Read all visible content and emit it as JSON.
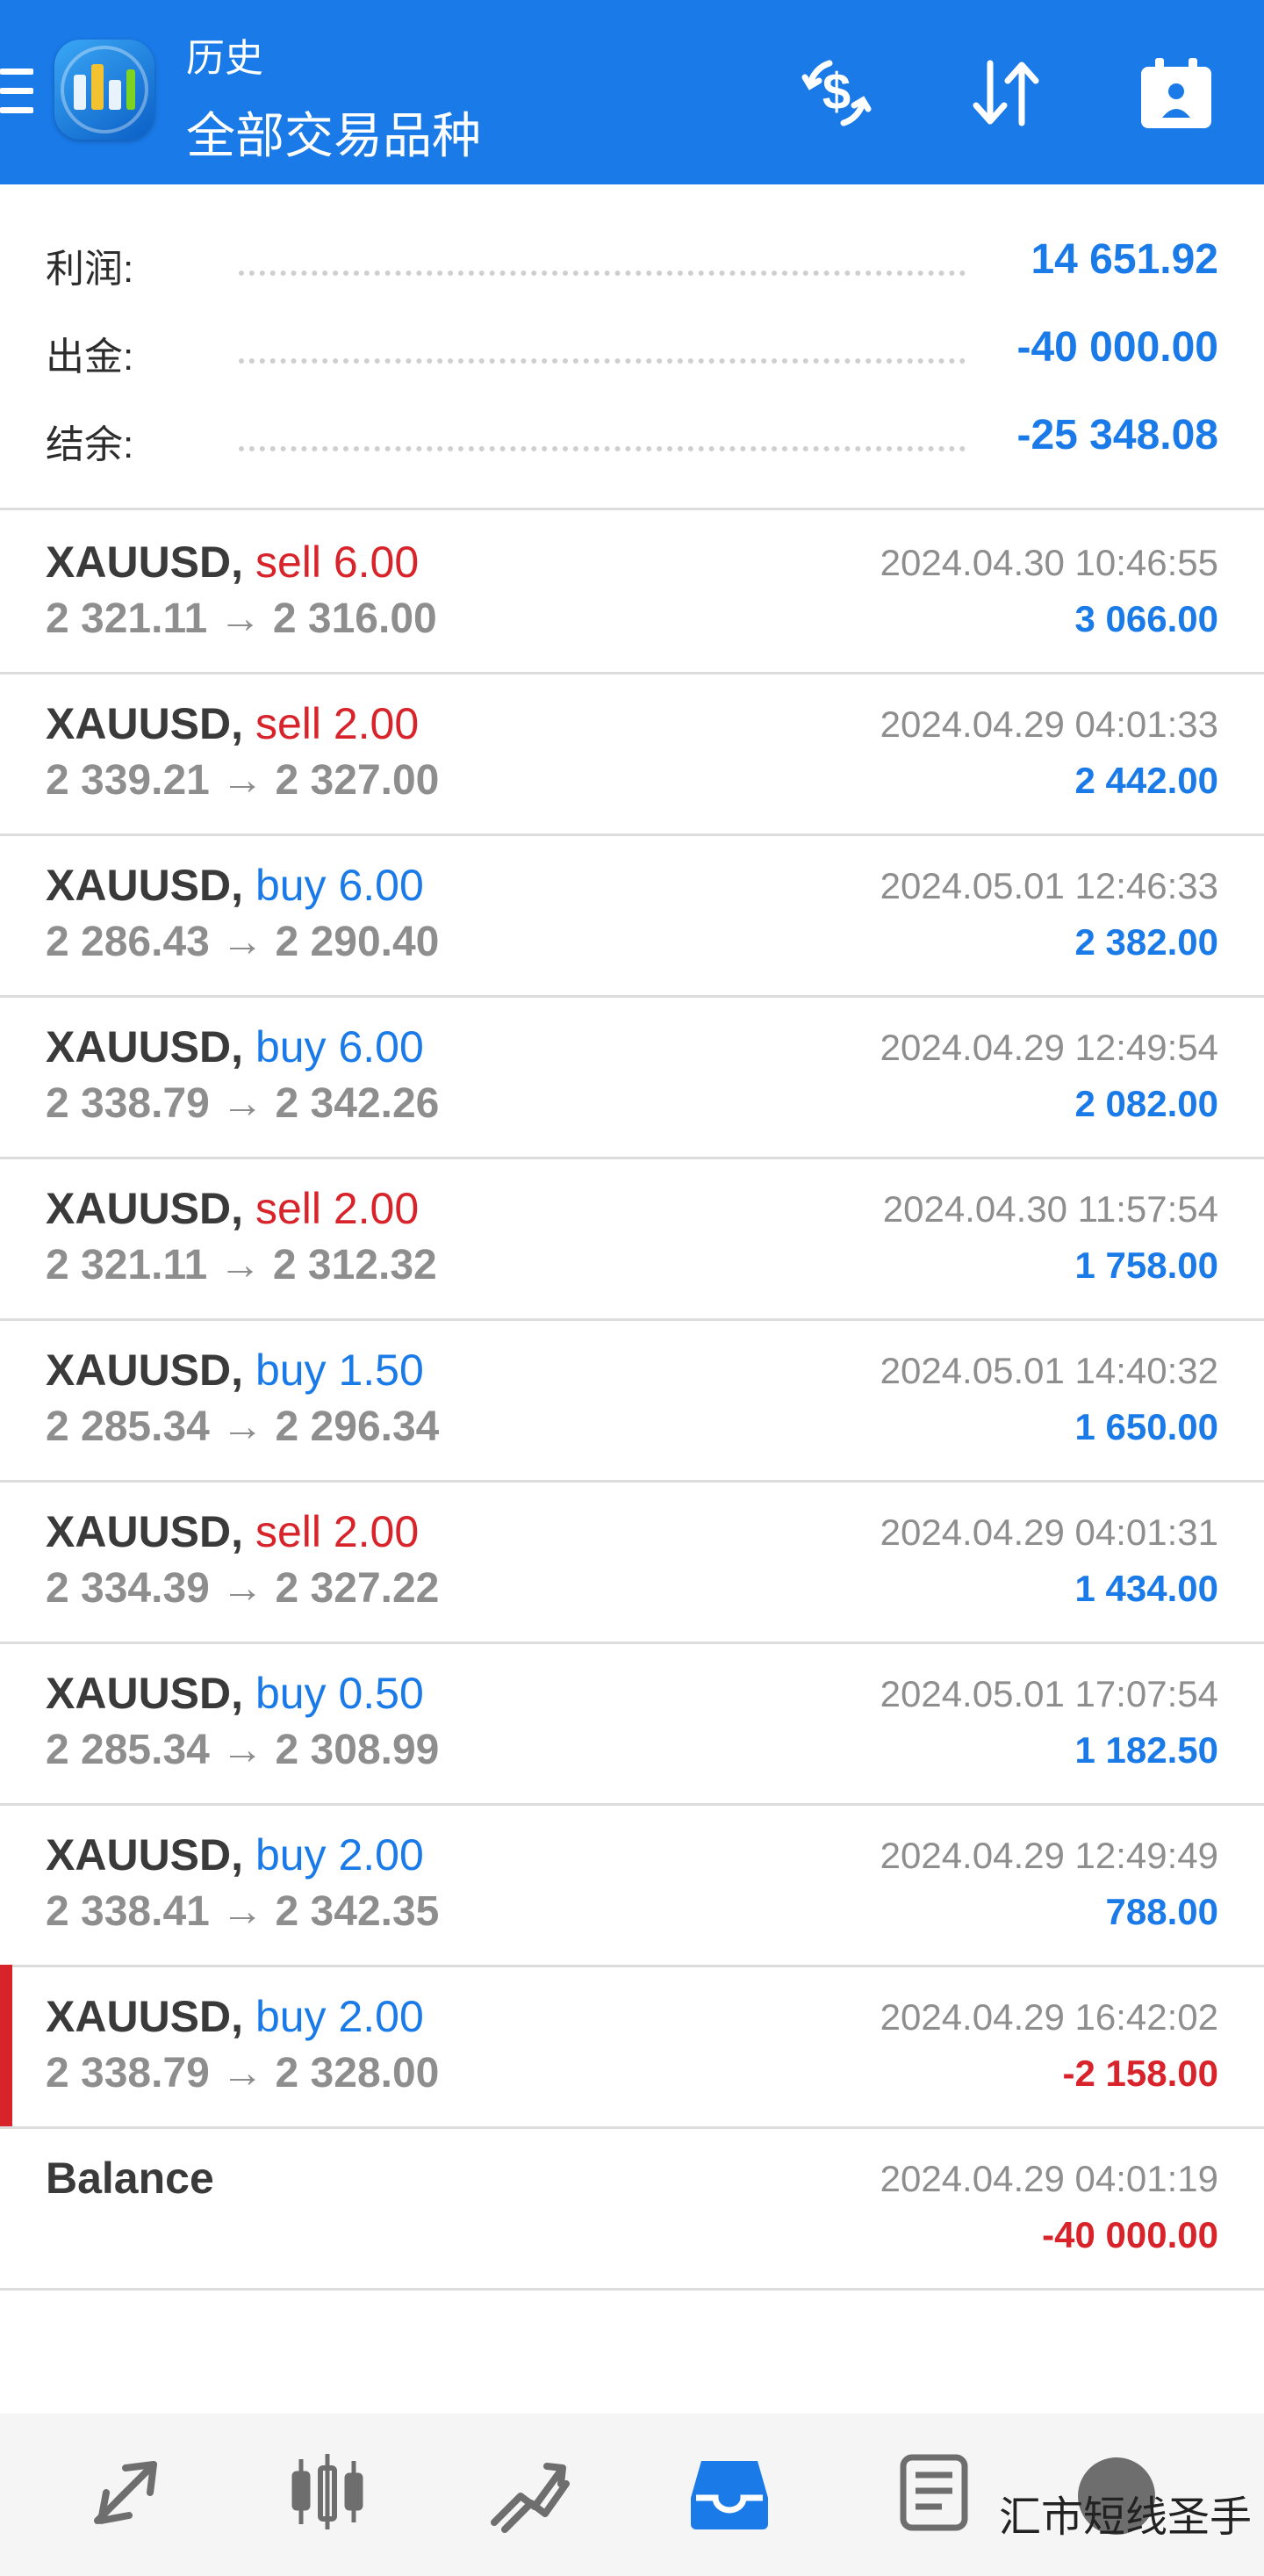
{
  "header": {
    "title_top": "历史",
    "title_main": "全部交易品种"
  },
  "summary": [
    {
      "label": "利润:",
      "value": "14 651.92"
    },
    {
      "label": "出金:",
      "value": "-40 000.00"
    },
    {
      "label": "结余:",
      "value": "-25 348.08"
    }
  ],
  "deals": [
    {
      "symbol": "XAUUSD,",
      "dir": "sell 6.00",
      "side": "sell",
      "prices": "2 321.11 → 2 316.00",
      "time": "2024.04.30 10:46:55",
      "profit": "3 066.00",
      "profit_color": "#1a7ae8"
    },
    {
      "symbol": "XAUUSD,",
      "dir": "sell 2.00",
      "side": "sell",
      "prices": "2 339.21 → 2 327.00",
      "time": "2024.04.29 04:01:33",
      "profit": "2 442.00",
      "profit_color": "#1a7ae8"
    },
    {
      "symbol": "XAUUSD,",
      "dir": "buy 6.00",
      "side": "buy",
      "prices": "2 286.43 → 2 290.40",
      "time": "2024.05.01 12:46:33",
      "profit": "2 382.00",
      "profit_color": "#1a7ae8"
    },
    {
      "symbol": "XAUUSD,",
      "dir": "buy 6.00",
      "side": "buy",
      "prices": "2 338.79 → 2 342.26",
      "time": "2024.04.29 12:49:54",
      "profit": "2 082.00",
      "profit_color": "#1a7ae8"
    },
    {
      "symbol": "XAUUSD,",
      "dir": "sell 2.00",
      "side": "sell",
      "prices": "2 321.11 → 2 312.32",
      "time": "2024.04.30 11:57:54",
      "profit": "1 758.00",
      "profit_color": "#1a7ae8"
    },
    {
      "symbol": "XAUUSD,",
      "dir": "buy 1.50",
      "side": "buy",
      "prices": "2 285.34 → 2 296.34",
      "time": "2024.05.01 14:40:32",
      "profit": "1 650.00",
      "profit_color": "#1a7ae8"
    },
    {
      "symbol": "XAUUSD,",
      "dir": "sell 2.00",
      "side": "sell",
      "prices": "2 334.39 → 2 327.22",
      "time": "2024.04.29 04:01:31",
      "profit": "1 434.00",
      "profit_color": "#1a7ae8"
    },
    {
      "symbol": "XAUUSD,",
      "dir": "buy 0.50",
      "side": "buy",
      "prices": "2 285.34 → 2 308.99",
      "time": "2024.05.01 17:07:54",
      "profit": "1 182.50",
      "profit_color": "#1a7ae8"
    },
    {
      "symbol": "XAUUSD,",
      "dir": "buy 2.00",
      "side": "buy",
      "prices": "2 338.41 → 2 342.35",
      "time": "2024.04.29 12:49:49",
      "profit": "788.00",
      "profit_color": "#1a7ae8"
    },
    {
      "symbol": "XAUUSD,",
      "dir": "buy 2.00",
      "side": "buy",
      "prices": "2 338.79 → 2 328.00",
      "time": "2024.04.29 16:42:02",
      "profit": "-2 158.00",
      "profit_color": "#d8232a",
      "loss": true
    },
    {
      "symbol": "Balance",
      "dir": "",
      "side": "",
      "prices": "",
      "time": "2024.04.29 04:01:19",
      "profit": "-40 000.00",
      "profit_color": "#d8232a"
    }
  ],
  "colors": {
    "sell": "#d8232a",
    "buy": "#1a7ae8",
    "accent": "#1a7ae8"
  },
  "bottom_nav": [
    {
      "icon": "quotes-icon"
    },
    {
      "icon": "chart-icon"
    },
    {
      "icon": "trade-icon"
    },
    {
      "icon": "history-icon",
      "active": true
    },
    {
      "icon": "news-icon"
    },
    {
      "icon": "settings-icon"
    }
  ],
  "watermark": "汇市短线圣手"
}
